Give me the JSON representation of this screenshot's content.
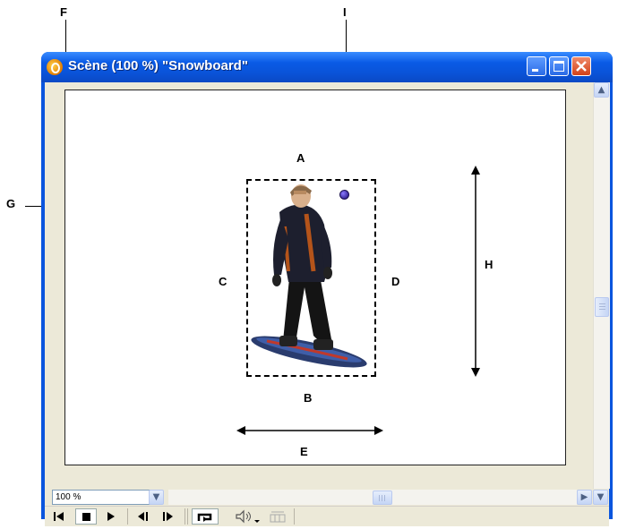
{
  "window": {
    "title": "Scène (100 %) \"Snowboard\"",
    "app_icon": "director-icon",
    "buttons": {
      "minimize": "minimize-icon",
      "maximize": "maximize-icon",
      "close": "close-icon"
    }
  },
  "callouts": {
    "A": "A",
    "B": "B",
    "C": "C",
    "D": "D",
    "E": "E",
    "F": "F",
    "G": "G",
    "H": "H",
    "I": "I"
  },
  "zoom": {
    "value": "100 %"
  },
  "playback": {
    "rewind": "rewind-icon",
    "stop": "stop-icon",
    "play": "play-icon",
    "step_back": "step-back-icon",
    "step_forward": "step-forward-icon",
    "loop": "loop-icon",
    "volume": "volume-icon",
    "selected_frames": "selected-frames-icon"
  },
  "colors": {
    "titlebar": "#0a55de",
    "stage": "#ffffff",
    "registration_point": "#3a2a9a"
  }
}
